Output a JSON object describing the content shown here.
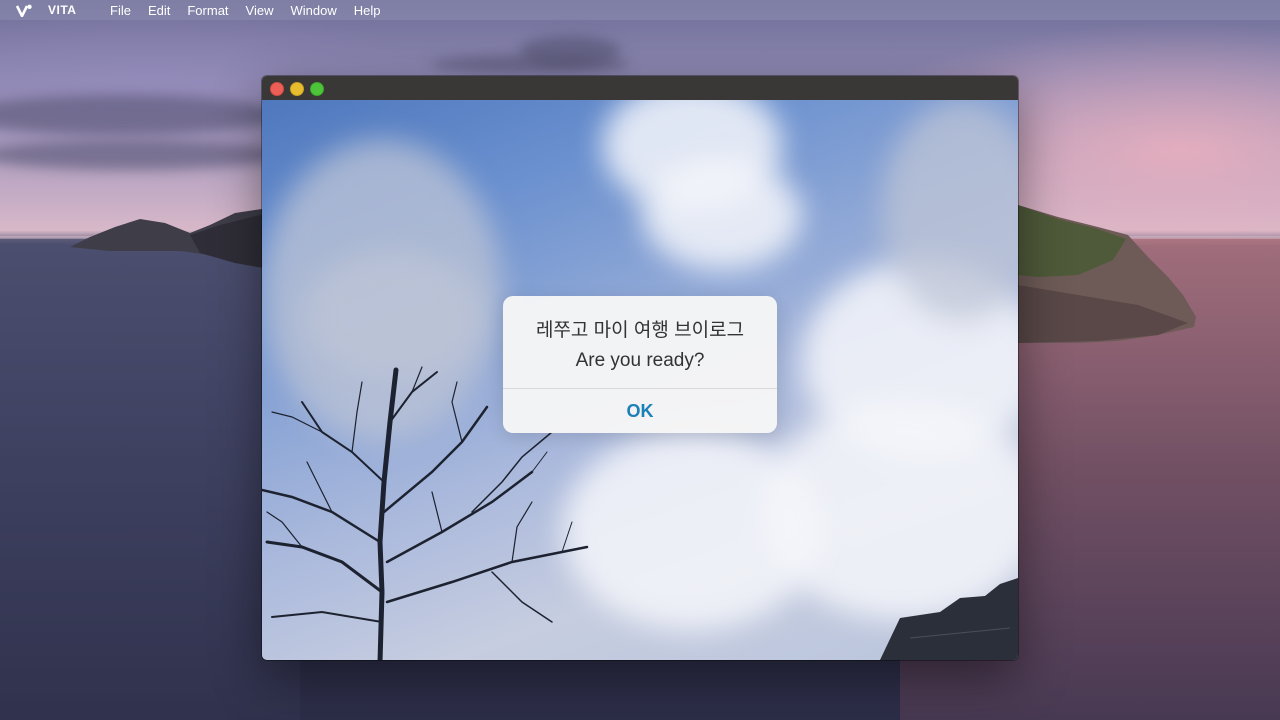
{
  "menubar": {
    "app_name": "VITA",
    "app_logo": "vita-logo-icon",
    "items": [
      "File",
      "Edit",
      "Format",
      "View",
      "Window",
      "Help"
    ]
  },
  "window": {
    "traffic_lights": {
      "close_color": "#ec5f57",
      "minimize_color": "#e7bd2f",
      "zoom_color": "#4ec43a"
    }
  },
  "dialog": {
    "line1": "레쭈고 마이 여행 브이로그",
    "line2": "Are you ready?",
    "ok_label": "OK",
    "ok_color": "#1b7fb8"
  }
}
